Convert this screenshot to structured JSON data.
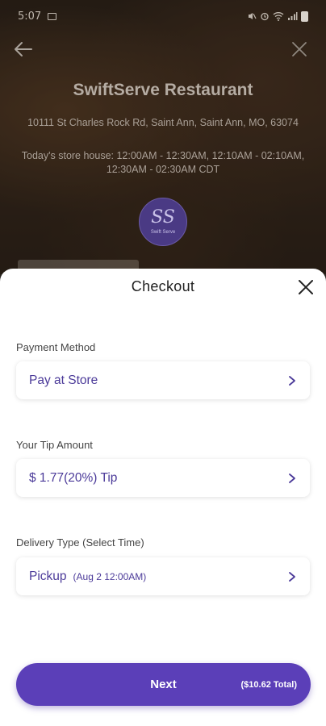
{
  "status_bar": {
    "time": "5:07",
    "right_icons": [
      "mute-icon",
      "alarm-icon",
      "wifi-icon",
      "signal-icon",
      "battery-icon"
    ]
  },
  "store": {
    "name": "SwiftServe Restaurant",
    "address": "10111 St Charles Rock Rd, Saint Ann, Saint Ann, MO, 63074",
    "hours": "Today's store house: 12:00AM - 12:30AM, 12:10AM - 02:10AM, 12:30AM - 02:30AM CDT",
    "logo_mark": "SS",
    "logo_caption": "Swift Serve"
  },
  "checkout": {
    "title": "Checkout",
    "payment": {
      "label": "Payment Method",
      "value": "Pay at Store"
    },
    "tip": {
      "label": "Your Tip Amount",
      "value": "$ 1.77(20%) Tip"
    },
    "delivery": {
      "label": "Delivery Type (Select Time)",
      "value": "Pickup",
      "time": "(Aug 2  12:00AM)"
    },
    "next_button": {
      "label": "Next",
      "total": "($10.62 Total)"
    }
  },
  "colors": {
    "accent": "#5b3fb8",
    "accent_text": "#4b3a99"
  }
}
